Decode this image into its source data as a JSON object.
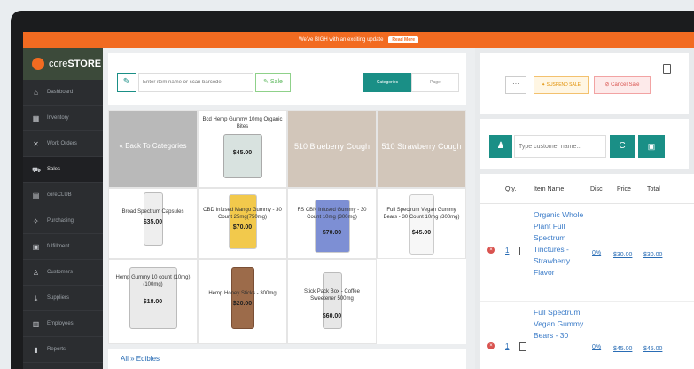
{
  "banner": {
    "text": "We've BIGH with an exciting update",
    "pill": "Read More"
  },
  "brand": {
    "prefix": "core",
    "name": "STORE"
  },
  "sidebar": {
    "items": [
      {
        "label": "Dashboard",
        "icon": "dashboard-icon",
        "glyph": "⌂"
      },
      {
        "label": "Inventory",
        "icon": "inventory-icon",
        "glyph": "▦"
      },
      {
        "label": "Work Orders",
        "icon": "tools-icon",
        "glyph": "✕"
      },
      {
        "label": "Sales",
        "icon": "cart-icon",
        "glyph": "⛟"
      },
      {
        "label": "coreCLUB",
        "icon": "club-icon",
        "glyph": "▤"
      },
      {
        "label": "Purchasing",
        "icon": "purchasing-icon",
        "glyph": "✧"
      },
      {
        "label": "fulfillment",
        "icon": "fulfillment-icon",
        "glyph": "▣"
      },
      {
        "label": "Customers",
        "icon": "customers-icon",
        "glyph": "♙"
      },
      {
        "label": "Suppliers",
        "icon": "suppliers-icon",
        "glyph": "⤓"
      },
      {
        "label": "Employees",
        "icon": "employees-icon",
        "glyph": "▥"
      },
      {
        "label": "Reports",
        "icon": "reports-icon",
        "glyph": "▮"
      }
    ]
  },
  "search": {
    "placeholder": "Enter item name or scan barcode",
    "sale_label": "Sale",
    "edit_glyph": "✎"
  },
  "tabs": {
    "categories": "Categories",
    "page": "Page"
  },
  "tiles": [
    {
      "label": "« Back To Categories",
      "price": ""
    },
    {
      "label": "Bcd Hemp Gummy 10mg Organic Bites",
      "price": "$45.00"
    },
    {
      "label": "510 Blueberry Cough",
      "price": ""
    },
    {
      "label": "510 Strawberry Cough",
      "price": ""
    },
    {
      "label": "Broad Spectrum Capsules",
      "price": "$35.00"
    },
    {
      "label": "CBD Infused Mango Gummy - 30 Count 25mg(750mg)",
      "price": "$70.00"
    },
    {
      "label": "FS CBN Infused Gummy - 30 Count 10mg (300mg)",
      "price": "$70.00"
    },
    {
      "label": "Full Spectrum Vegan Gummy Bears - 30 Count 10mg (300mg)",
      "price": "$45.00"
    },
    {
      "label": "Hemp Gummy 10 count (10mg) (100mg)",
      "price": "$18.00"
    },
    {
      "label": "Hemp Honey Sticks - 300mg",
      "price": "$20.00"
    },
    {
      "label": "Stick Pack Box - Coffee Sweetener 500mg",
      "price": "$60.00"
    }
  ],
  "breadcrumb": {
    "text": "All » Edibles"
  },
  "actions": {
    "dots": "···",
    "suspend": "✦ SUSPEND SALE",
    "cancel": "⊘ Cancel Sale"
  },
  "customer": {
    "placeholder": "Type customer name...",
    "user_glyph": "♟",
    "refresh_glyph": "C",
    "card_glyph": "▣"
  },
  "cart": {
    "headers": {
      "qty": "Qty.",
      "item": "Item Name",
      "disc": "Disc",
      "price": "Price",
      "total": "Total"
    },
    "rows": [
      {
        "qty": "1",
        "name": "Organic Whole Plant Full Spectrum Tinctures - Strawberry Flavor",
        "disc": "0%",
        "price": "$30.00",
        "total": "$30.00"
      },
      {
        "qty": "1",
        "name": "Full Spectrum Vegan Gummy Bears - 30",
        "disc": "0%",
        "price": "$45.00",
        "total": "$45.00"
      }
    ]
  },
  "colors": {
    "accent": "#f26b21",
    "teal": "#1a8f86",
    "sidebar": "#2b2d30",
    "link": "#2a6db5"
  }
}
